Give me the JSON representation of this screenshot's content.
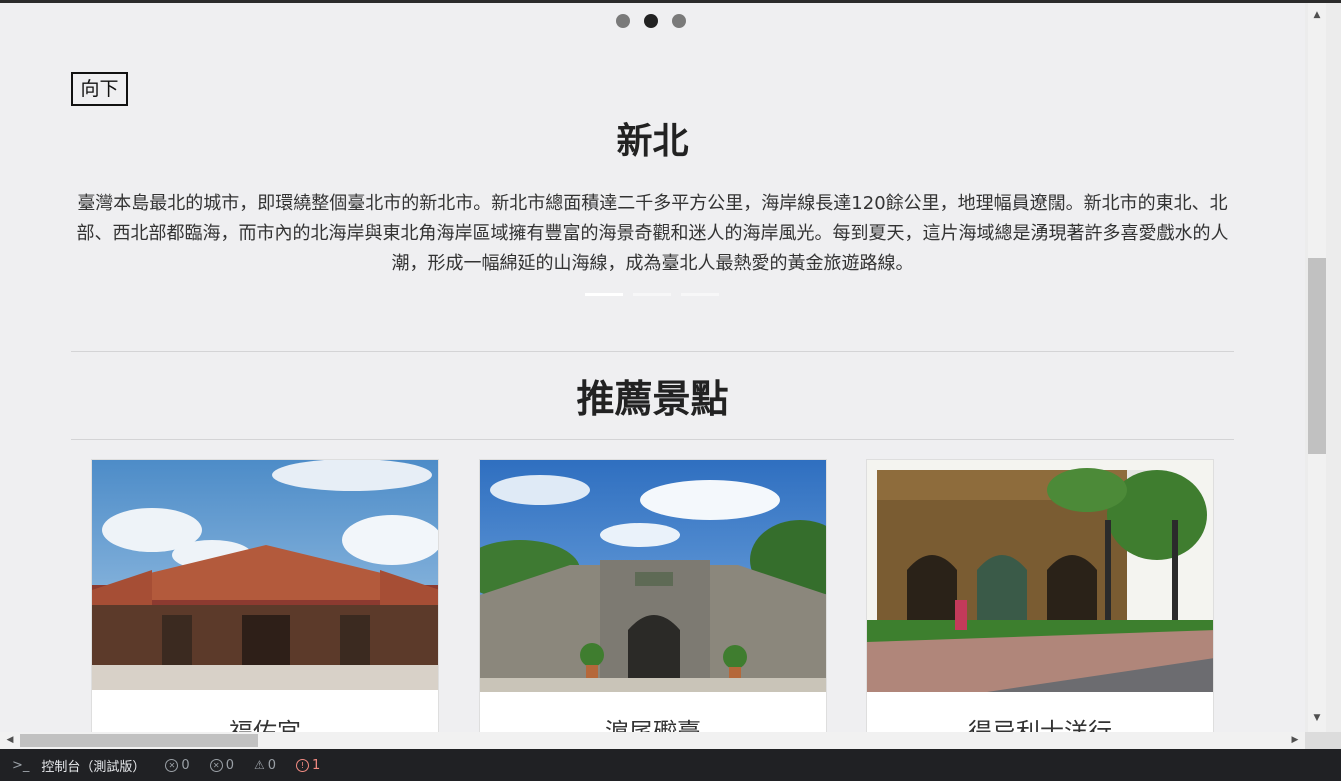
{
  "carousel": {
    "dots": 3,
    "active_dot": 1,
    "down_button": "向下",
    "title": "新北",
    "description": "臺灣本島最北的城市，即環繞整個臺北市的新北市。新北市總面積達二千多平方公里，海岸線長達120餘公里，地理幅員遼闊。新北市的東北、北部、西北部都臨海，而市內的北海岸與東北角海岸區域擁有豐富的海景奇觀和迷人的海岸風光。每到夏天，這片海域總是湧現著許多喜愛戲水的人潮，形成一幅綿延的山海線，成為臺北人最熱愛的黃金旅遊路線。",
    "indicators": 3,
    "active_indicator": 0
  },
  "section": {
    "title": "推薦景點"
  },
  "cards": [
    {
      "name": "福佑宮",
      "image": "temple-photo"
    },
    {
      "name": "滬尾礮臺",
      "image": "fort-gate-photo"
    },
    {
      "name": "得忌利士洋行",
      "image": "old-building-photo"
    }
  ],
  "console": {
    "label": "控制台（測試版）",
    "errors_a": "0",
    "errors_b": "0",
    "warnings": "0",
    "issues": "1"
  },
  "colors": {
    "page_bg": "#efeff1",
    "console_bg": "#202124",
    "issue_red": "#f28b82"
  }
}
